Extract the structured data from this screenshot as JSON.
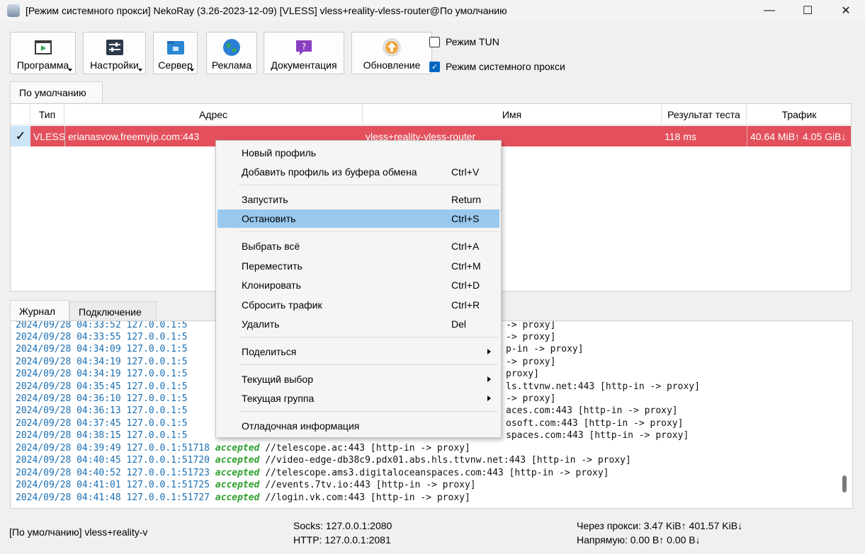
{
  "window": {
    "title": "[Режим системного прокси] NekoRay (3.26-2023-12-09) [VLESS] vless+reality-vless-router@По умолчанию",
    "minimize": "—",
    "maximize": "☐",
    "close": "✕"
  },
  "toolbar": {
    "program": "Программа",
    "settings": "Настройки",
    "server": "Сервер",
    "ads": "Реклама",
    "docs": "Документация",
    "update": "Обновление",
    "tun_label": "Режим TUN",
    "tun_checked": false,
    "sysproxy_label": "Режим системного прокси",
    "sysproxy_checked": true
  },
  "group_tab": "По умолчанию",
  "table": {
    "headers": [
      "Тип",
      "Адрес",
      "Имя",
      "Результат теста",
      "Трафик"
    ],
    "rows": [
      {
        "check": "✓",
        "type": "VLESS",
        "address": "erianasvow.freemyip.com:443",
        "name": "vless+reality-vless-router",
        "test": "118 ms",
        "traffic": "40.64 MiB↑ 4.05 GiB↓"
      }
    ],
    "selected_color": "#e3505c"
  },
  "log_tabs": [
    "Журнал",
    "Подключение"
  ],
  "log": [
    {
      "ts": "2024/09/28 04:33:52 127.0.0.1:5",
      "accepted": "",
      "rest": "",
      "tail": "-> proxy]"
    },
    {
      "ts": "2024/09/28 04:33:55 127.0.0.1:5",
      "accepted": "",
      "rest": "",
      "tail": "-> proxy]"
    },
    {
      "ts": "2024/09/28 04:34:09 127.0.0.1:5",
      "accepted": "",
      "rest": "",
      "tail": "p-in -> proxy]"
    },
    {
      "ts": "2024/09/28 04:34:19 127.0.0.1:5",
      "accepted": "",
      "rest": "",
      "tail": "-> proxy]"
    },
    {
      "ts": "2024/09/28 04:34:19 127.0.0.1:5",
      "accepted": "",
      "rest": "",
      "tail": "proxy]"
    },
    {
      "ts": "2024/09/28 04:35:45 127.0.0.1:5",
      "accepted": "",
      "rest": "",
      "tail": "ls.ttvnw.net:443 [http-in -> proxy]"
    },
    {
      "ts": "2024/09/28 04:36:10 127.0.0.1:5",
      "accepted": "",
      "rest": "",
      "tail": "-> proxy]"
    },
    {
      "ts": "2024/09/28 04:36:13 127.0.0.1:5",
      "accepted": "",
      "rest": "",
      "tail": "aces.com:443 [http-in -> proxy]"
    },
    {
      "ts": "2024/09/28 04:37:45 127.0.0.1:5",
      "accepted": "",
      "rest": "",
      "tail": "osoft.com:443 [http-in -> proxy]"
    },
    {
      "ts": "2024/09/28 04:38:15 127.0.0.1:5",
      "accepted": "",
      "rest": "",
      "tail": "spaces.com:443 [http-in -> proxy]"
    },
    {
      "ts": "2024/09/28 04:39:49 127.0.0.1:51718 ",
      "accepted": "accepted",
      "rest": " //telescope.ac:443 [http-in -> proxy]",
      "tail": ""
    },
    {
      "ts": "2024/09/28 04:40:45 127.0.0.1:51720 ",
      "accepted": "accepted",
      "rest": " //video-edge-db38c9.pdx01.abs.hls.ttvnw.net:443 [http-in -> proxy]",
      "tail": ""
    },
    {
      "ts": "2024/09/28 04:40:52 127.0.0.1:51723 ",
      "accepted": "accepted",
      "rest": " //telescope.ams3.digitaloceanspaces.com:443 [http-in -> proxy]",
      "tail": ""
    },
    {
      "ts": "2024/09/28 04:41:01 127.0.0.1:51725 ",
      "accepted": "accepted",
      "rest": " //events.7tv.io:443 [http-in -> proxy]",
      "tail": ""
    },
    {
      "ts": "2024/09/28 04:41:48 127.0.0.1:51727 ",
      "accepted": "accepted",
      "rest": " //login.vk.com:443 [http-in -> proxy]",
      "tail": ""
    }
  ],
  "status": {
    "profile": "[По умолчанию] vless+reality-v",
    "socks": "Socks: 127.0.0.1:2080",
    "http": "HTTP: 127.0.0.1:2081",
    "via_proxy": "Через прокси: 3.47 KiB↑ 401.57 KiB↓",
    "direct": "Напрямую: 0.00 B↑ 0.00 B↓"
  },
  "context_menu": {
    "items": [
      {
        "label": "Новый профиль",
        "shortcut": ""
      },
      {
        "label": "Добавить профиль из буфера обмена",
        "shortcut": "Ctrl+V"
      },
      {
        "label": "Запустить",
        "shortcut": "Return"
      },
      {
        "label": "Остановить",
        "shortcut": "Ctrl+S"
      },
      {
        "label": "Выбрать всё",
        "shortcut": "Ctrl+A"
      },
      {
        "label": "Переместить",
        "shortcut": "Ctrl+M"
      },
      {
        "label": "Клонировать",
        "shortcut": "Ctrl+D"
      },
      {
        "label": "Сбросить трафик",
        "shortcut": "Ctrl+R"
      },
      {
        "label": "Удалить",
        "shortcut": "Del"
      },
      {
        "label": "Поделиться",
        "shortcut": ""
      },
      {
        "label": "Текущий выбор",
        "shortcut": ""
      },
      {
        "label": "Текущая группа",
        "shortcut": ""
      },
      {
        "label": "Отладочная информация",
        "shortcut": ""
      }
    ]
  }
}
